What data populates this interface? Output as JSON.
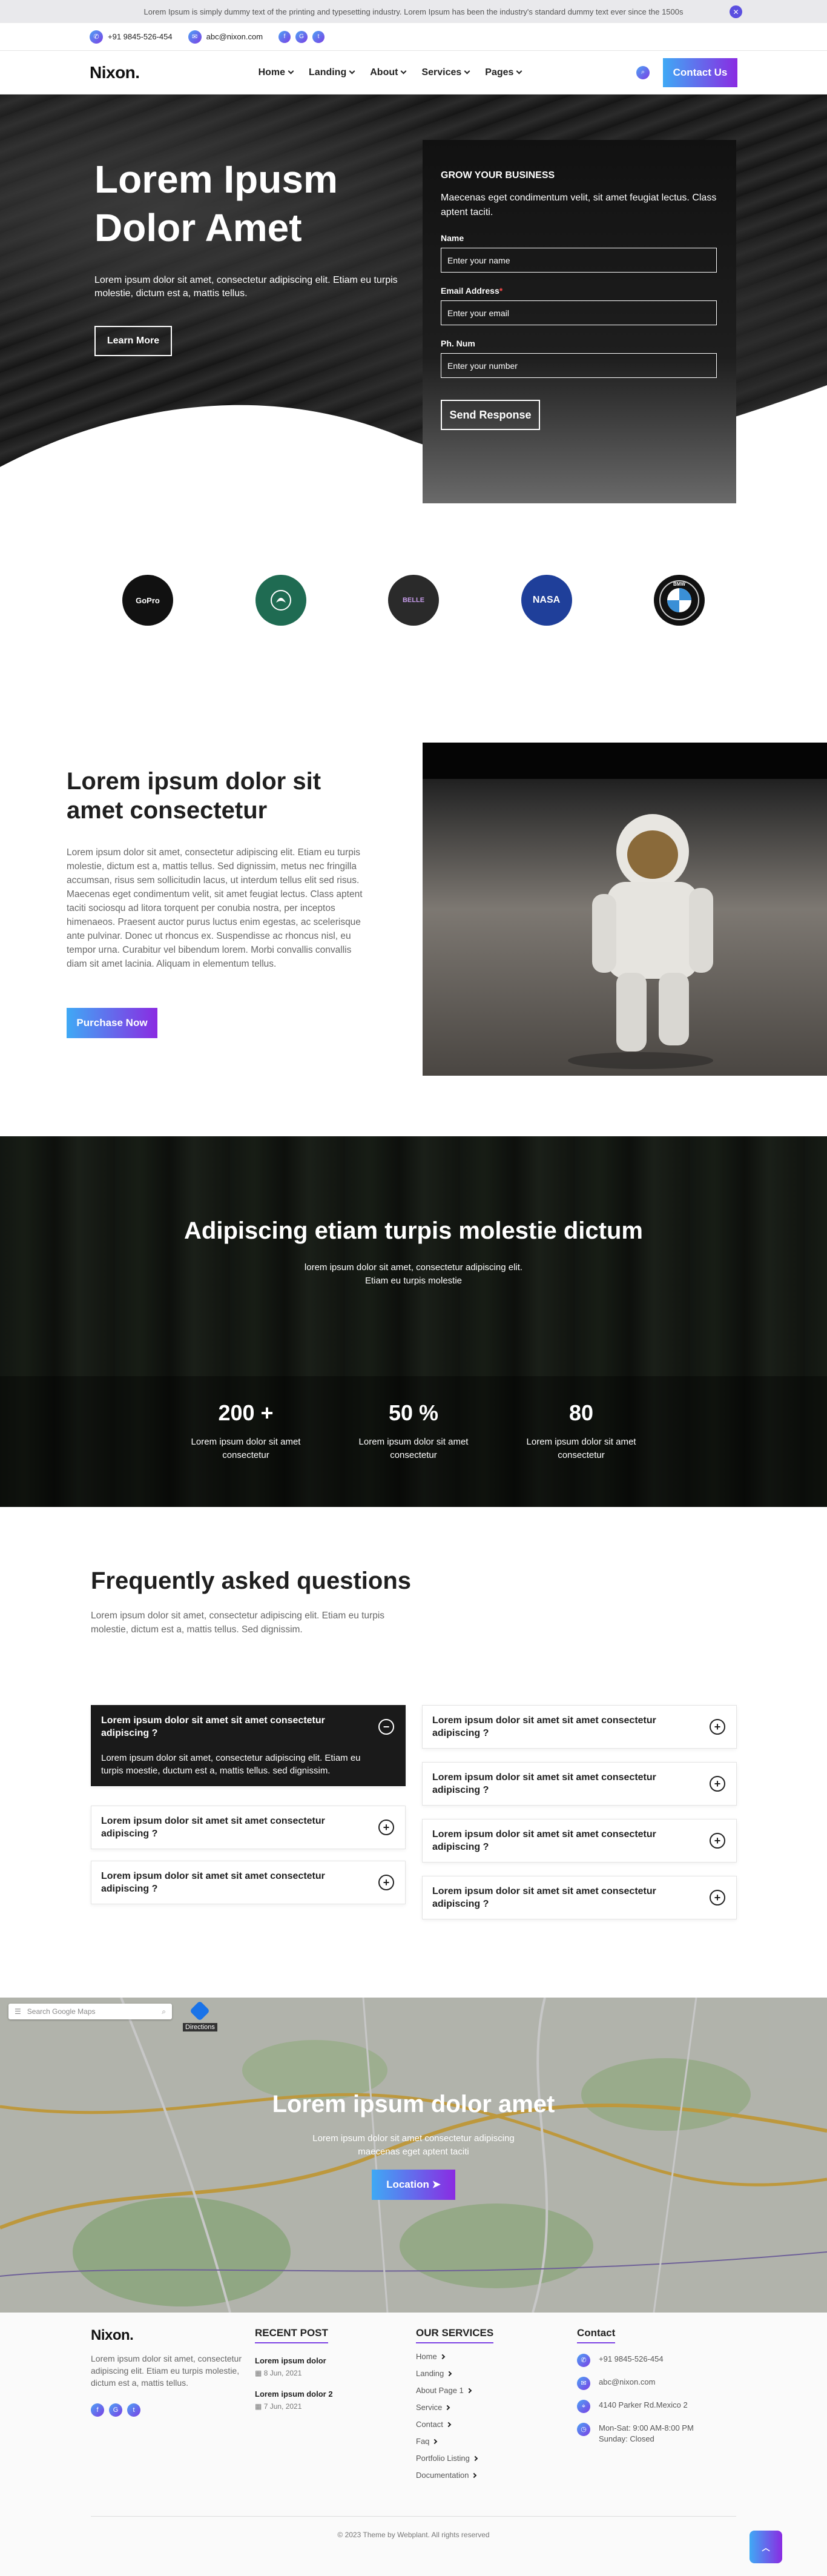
{
  "notice": {
    "text": "Lorem Ipsum is simply dummy text of the printing and typesetting industry. Lorem Ipsum has been the industry's standard dummy text ever since the 1500s"
  },
  "contactbar": {
    "phone": "+91 9845-526-454",
    "email": "abc@nixon.com"
  },
  "nav": {
    "logo": "Nixon.",
    "items": [
      "Home",
      "Landing",
      "About",
      "Services",
      "Pages"
    ],
    "contact_label": "Contact Us"
  },
  "hero": {
    "title": "Lorem Ipusm Dolor Amet",
    "text": "Lorem ipsum dolor sit amet, consectetur adipiscing elit. Etiam eu turpis molestie, dictum est a, mattis tellus.",
    "button": "Learn More"
  },
  "form": {
    "heading": "GROW YOUR BUSINESS",
    "text": "Maecenas eget condimentum velit, sit amet feugiat lectus. Class aptent taciti.",
    "name_label": "Name",
    "name_placeholder": "Enter your name",
    "email_label": "Email Address",
    "email_placeholder": "Enter your email",
    "phone_label": "Ph. Num",
    "phone_placeholder": "Enter your number",
    "submit": "Send Response"
  },
  "brands": [
    "GoPro",
    "",
    "BELLE",
    "NASA",
    "BMW"
  ],
  "about": {
    "title": "Lorem ipsum dolor sit amet consectetur",
    "text": "Lorem ipsum dolor sit amet, consectetur adipiscing elit. Etiam eu turpis molestie, dictum est a, mattis tellus. Sed dignissim, metus nec fringilla accumsan, risus sem sollicitudin lacus, ut interdum tellus elit sed risus. Maecenas eget condimentum velit, sit amet feugiat lectus. Class aptent taciti sociosqu ad litora torquent per conubia nostra, per inceptos himenaeos. Praesent auctor purus luctus enim egestas, ac scelerisque ante pulvinar. Donec ut rhoncus ex. Suspendisse ac rhoncus nisl, eu tempor urna. Curabitur vel bibendum lorem. Morbi convallis convallis diam sit amet lacinia. Aliquam in elementum tellus.",
    "button": "Purchase Now"
  },
  "stats": {
    "title": "Adipiscing etiam turpis molestie dictum",
    "sub": "lorem ipsum dolor sit amet, consectetur adipiscing elit. Etiam eu turpis molestie",
    "items": [
      {
        "num": "200 +",
        "label": "Lorem ipsum dolor sit amet consectetur"
      },
      {
        "num": "50 %",
        "label": "Lorem ipsum dolor sit amet consectetur"
      },
      {
        "num": "80",
        "label": "Lorem ipsum dolor sit amet consectetur"
      }
    ]
  },
  "faq": {
    "title": "Frequently asked questions",
    "intro": "Lorem ipsum dolor sit amet, consectetur adipiscing elit. Etiam eu turpis molestie, dictum est a, mattis tellus. Sed dignissim.",
    "question": "Lorem ipsum dolor sit amet sit amet consectetur adipiscing ?",
    "answer": "Lorem ipsum dolor sit amet, consectetur adipiscing elit. Etiam eu turpis moestie, ductum est a, mattis tellus. sed dignissim.",
    "left": [
      "Lorem ipsum dolor sit amet sit amet consectetur adipiscing ?",
      "Lorem ipsum dolor sit amet sit amet consectetur adipiscing ?",
      "Lorem ipsum dolor sit amet sit amet consectetur adipiscing ?"
    ],
    "right": [
      "Lorem ipsum dolor sit amet sit amet consectetur adipiscing ?",
      "Lorem ipsum dolor sit amet sit amet consectetur adipiscing ?",
      "Lorem ipsum dolor sit amet sit amet consectetur adipiscing ?",
      "Lorem ipsum dolor sit amet sit amet consectetur adipiscing ?"
    ]
  },
  "map": {
    "search_placeholder": "Search Google Maps",
    "directions": "Directions",
    "title": "Lorem ipsum dolor amet",
    "sub": "Lorem ipsum dolor sit amet consectetur adipiscing maecenas eget aptent taciti",
    "button": "Location"
  },
  "footer": {
    "logo": "Nixon.",
    "about": "Lorem ipsum dolor sit amet, consectetur adipiscing elit. Etiam eu turpis molestie, dictum est a, mattis tellus.",
    "recent_title": "RECENT POST",
    "posts": [
      {
        "title": "Lorem ipsum dolor",
        "date": "8 Jun, 2021"
      },
      {
        "title": "Lorem ipsum dolor 2",
        "date": "7 Jun, 2021"
      }
    ],
    "services_title": "OUR SERVICES",
    "services": [
      "Home",
      "Landing",
      "About Page 1",
      "Service",
      "Contact",
      "Faq",
      "Portfolio Listing",
      "Documentation"
    ],
    "contact_title": "Contact",
    "phone": "+91 9845-526-454",
    "email": "abc@nixon.com",
    "address": "4140 Parker Rd.Mexico 2",
    "hours": "Mon-Sat: 9:00 AM-8:00 PM Sunday: Closed",
    "copyright": "© 2023 Theme by Webplant. All rights reserved"
  },
  "colors": {
    "accent_start": "#3fa9f5",
    "accent_end": "#8a2be2",
    "dark": "#1a1a1a"
  }
}
